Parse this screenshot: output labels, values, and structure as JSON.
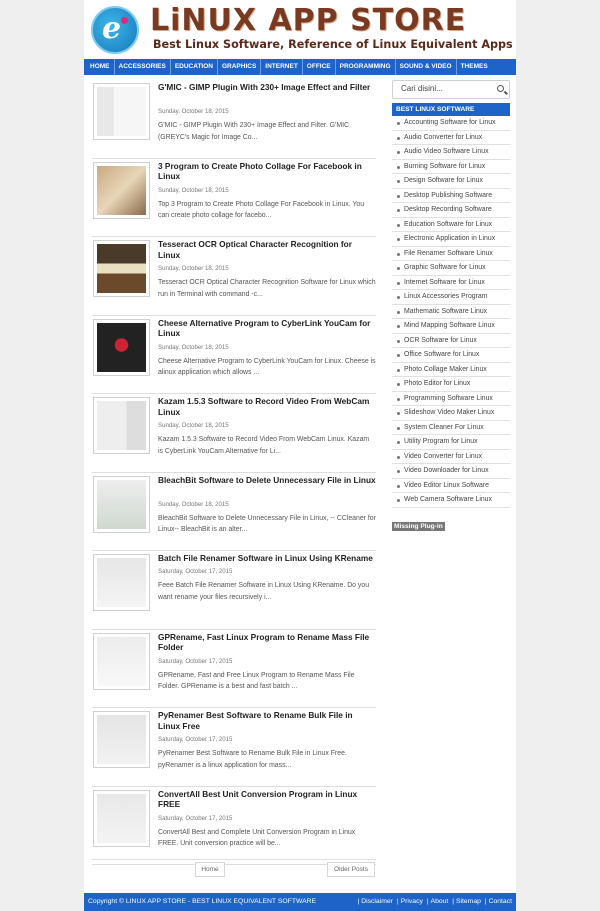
{
  "header": {
    "title": "LiNUX APP STORE",
    "tagline": "Best Linux Software, Reference of Linux Equivalent Apps"
  },
  "nav": [
    "HOME",
    "ACCESSORIES",
    "EDUCATION",
    "GRAPHICS",
    "INTERNET",
    "OFFICE",
    "PROGRAMMING",
    "SOUND & VIDEO",
    "THEMES"
  ],
  "posts": [
    {
      "title": "G'MIC - GIMP Plugin With 230+ Image Effect and Filter",
      "date": "Sunday, October 18, 2015",
      "excerpt": "G'MIC - GIMP Plugin With 230+ Image Effect and Filter. G'MIC (GREYC's Magic for Image Co..."
    },
    {
      "title": "3 Program to Create Photo Collage For Facebook in Linux",
      "date": "Sunday, October 18, 2015",
      "excerpt": "Top 3 Program to Create Photo Collage For Facebook in Linux. You can create photo collage for facebo..."
    },
    {
      "title": "Tesseract OCR Optical Character Recognition for Linux",
      "date": "Sunday, October 18, 2015",
      "excerpt": "Tesseract OCR Optical Character Recognition Software for Linux which run in Terminal with command -c..."
    },
    {
      "title": "Cheese Alternative Program to CyberLink YouCam for Linux",
      "date": "Sunday, October 18, 2015",
      "excerpt": "Cheese Alternative Program to CyberLink YouCam for Linux. Cheese is alinux application which allows ..."
    },
    {
      "title": "Kazam 1.5.3 Software to Record Video From WebCam Linux",
      "date": "Sunday, October 18, 2015",
      "excerpt": "Kazam 1.5.3 Software to Record Video From WebCam Linux. Kazam is CyberLink YouCam Alternative for Li..."
    },
    {
      "title": "BleachBit Software to Delete Unnecessary File in Linux",
      "date": "Sunday, October 18, 2015",
      "excerpt": "BleachBit Software to Delete Unnecessary File in Linux, -- CCleaner for Linux-- BleachBit is an alter..."
    },
    {
      "title": "Batch File Renamer Software in Linux Using KRename",
      "date": "Saturday, October 17, 2015",
      "excerpt": "Feee Batch File Renamer Software in Linux Using KRename. Do you want rename your files recursively i..."
    },
    {
      "title": "GPRename, Fast Linux Program to Rename Mass File Folder",
      "date": "Saturday, October 17, 2015",
      "excerpt": "GPRename, Fast and Free Linux Program to Rename Mass File Folder. GPRename is a best and fast batch ..."
    },
    {
      "title": "PyRenamer Best Software to Rename Bulk File in Linux Free",
      "date": "Saturday, October 17, 2015",
      "excerpt": "PyRenamer Best Software to Rename Bulk File in Linux Free. pyRenamer is a linux application for mass..."
    },
    {
      "title": "ConvertAll Best Unit Conversion Program in Linux FREE",
      "date": "Saturday, October 17, 2015",
      "excerpt": "ConvertAll Best and Complete Unit Conversion Program in Linux FREE. Unit conversion practice will be..."
    }
  ],
  "pager": {
    "home": "Home",
    "older": "Older Posts"
  },
  "sidebar": {
    "search_value": "Cari disini...",
    "widget_title": "BEST LINUX SOFTWARE",
    "categories": [
      "Accounting Software for Linux",
      "Audio Converter for Linux",
      "Audio Video Software Linux",
      "Burning Software for Linux",
      "Design Software for Linux",
      "Desktop Publishing Software",
      "Desktop Recording Software",
      "Education Software for Linux",
      "Electronic Application in Linux",
      "File Renamer Software Linux",
      "Graphic Software for Linux",
      "Internet Software for Linux",
      "Linux Accessories Program",
      "Mathematic Software Linux",
      "Mind Mapping Software Linux",
      "OCR Software for Linux",
      "Office Software for Linux",
      "Photo Collage Maker Linux",
      "Photo Editor for Linux",
      "Programming Software Linux",
      "Slideshow Video Maker Linux",
      "System Cleaner For Linux",
      "Utility Program for Linux",
      "Video Converter for Linux",
      "Video Downloader for Linux",
      "Video Editor Linux Software",
      "Web Camera Software Linux"
    ],
    "missing_plugin": "Missing Plug-in"
  },
  "footer": {
    "copyright": "Copyright © LINUX APP STORE - BEST LINUX EQUIVALENT SOFTWARE",
    "links": [
      "Disclaimer",
      "Privacy",
      "About",
      "Sitemap",
      "Contact"
    ]
  },
  "colors": {
    "accent": "#1d63c8",
    "title_brown": "#7a3a22"
  }
}
